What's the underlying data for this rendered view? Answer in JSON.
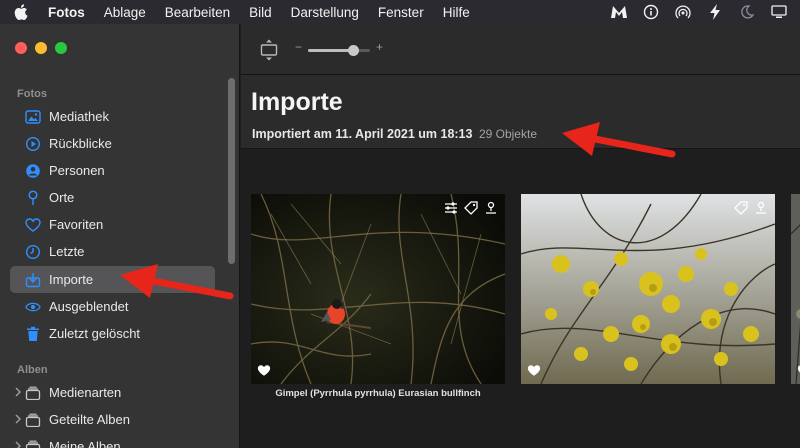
{
  "menubar": {
    "app": "Fotos",
    "menus": [
      "Ablage",
      "Bearbeiten",
      "Bild",
      "Darstellung",
      "Fenster",
      "Hilfe"
    ],
    "status_icons": [
      "malwarebytes-icon",
      "info-icon",
      "airdrop-icon",
      "bolt-icon",
      "moon-icon",
      "display-icon"
    ]
  },
  "sidebar": {
    "section_photos": "Fotos",
    "items": [
      {
        "label": "Mediathek",
        "icon": "photo-library-icon"
      },
      {
        "label": "Rückblicke",
        "icon": "memories-icon"
      },
      {
        "label": "Personen",
        "icon": "person-icon"
      },
      {
        "label": "Orte",
        "icon": "location-pin-icon"
      },
      {
        "label": "Favoriten",
        "icon": "heart-icon"
      },
      {
        "label": "Letzte",
        "icon": "clock-icon"
      },
      {
        "label": "Importe",
        "icon": "import-icon",
        "selected": true
      },
      {
        "label": "Ausgeblendet",
        "icon": "eye-icon"
      },
      {
        "label": "Zuletzt gelöscht",
        "icon": "trash-icon"
      }
    ],
    "section_albums": "Alben",
    "albums": [
      {
        "label": "Medienarten",
        "icon": "album-stack-icon"
      },
      {
        "label": "Geteilte Alben",
        "icon": "album-stack-icon"
      },
      {
        "label": "Meine Alben",
        "icon": "album-stack-icon"
      }
    ]
  },
  "toolbar": {
    "zoom_minus": "−",
    "zoom_plus": "+",
    "zoom_level": 0.72
  },
  "main": {
    "title": "Importe",
    "import_date": "Importiert am 11. April 2021 um 18:13",
    "object_count": "29 Objekte"
  },
  "photos": [
    {
      "caption": "Gimpel (Pyrrhula pyrrhula) Eurasian bullfinch",
      "icons": [
        "adjust-icon",
        "tag-icon",
        "keyword-icon"
      ]
    },
    {
      "caption": "",
      "icons": [
        "tag-icon",
        "keyword-icon"
      ]
    }
  ],
  "colors": {
    "accent": "#2f8fff",
    "annotation_arrow": "#e8251a",
    "sidebar_bg": "#343434",
    "main_bg": "#1e1e1e"
  }
}
